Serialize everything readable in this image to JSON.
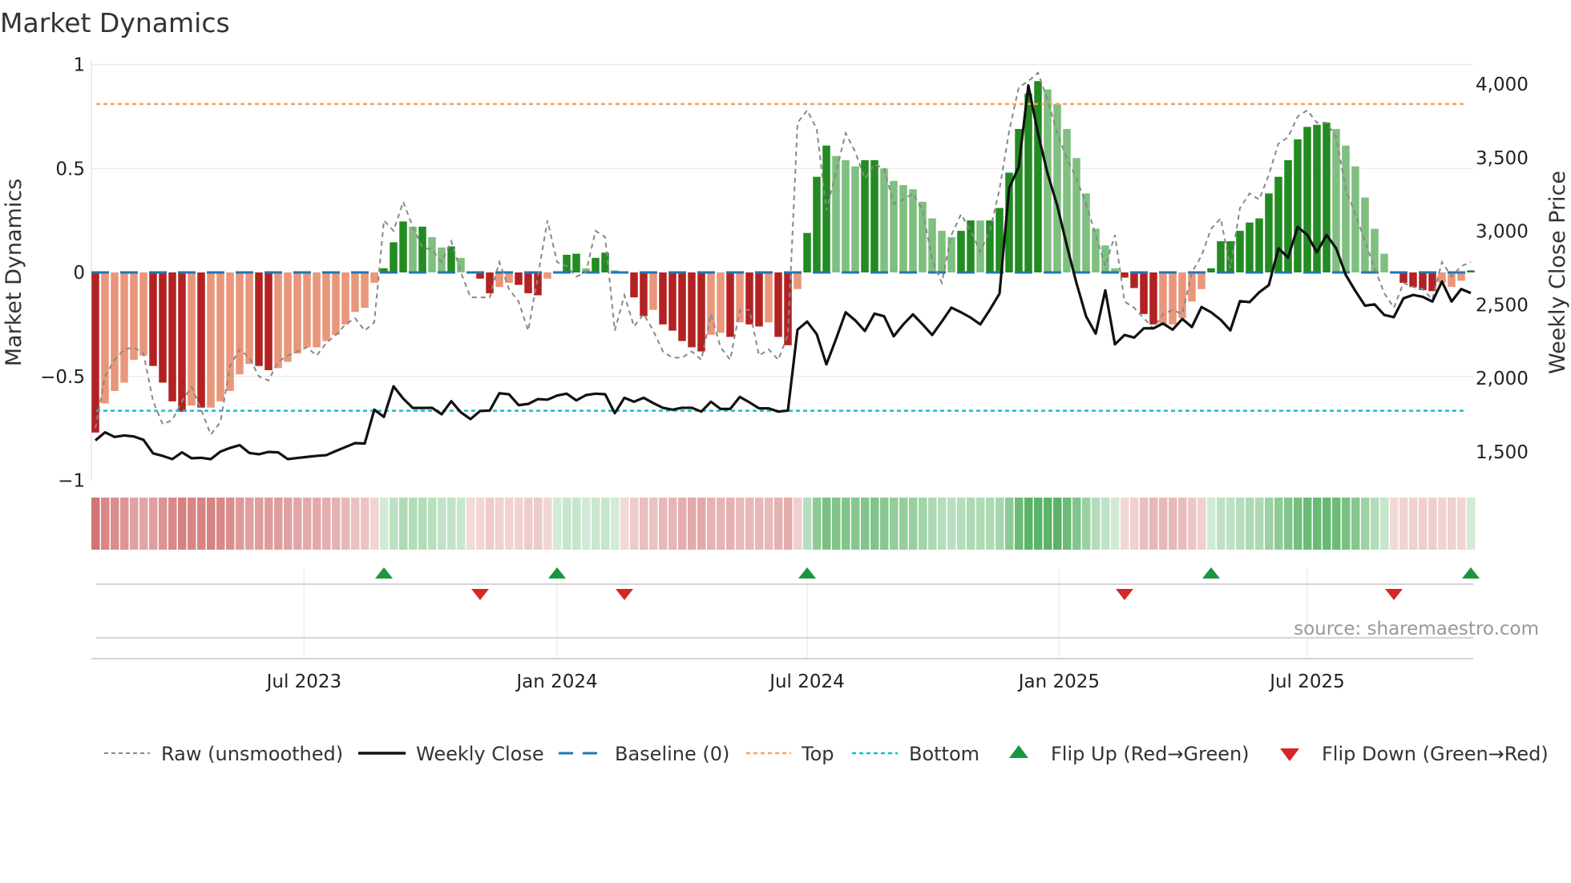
{
  "chart_data": {
    "type": "bar",
    "title": "Market Dynamics",
    "ylabel": "Market Dynamics",
    "y2label": "Weekly Close Price",
    "ylim": [
      -1,
      1
    ],
    "y2lim": [
      1200,
      4250
    ],
    "yticks": [
      {
        "v": 1,
        "label": "1"
      },
      {
        "v": 0.5,
        "label": "0.5"
      },
      {
        "v": 0,
        "label": "0"
      },
      {
        "v": -0.5,
        "label": "−0.5"
      },
      {
        "v": -1,
        "label": "−1"
      }
    ],
    "y2ticks": [
      {
        "v": 4000,
        "label": "4,000"
      },
      {
        "v": 3500,
        "label": "3,500"
      },
      {
        "v": 3000,
        "label": "3,000"
      },
      {
        "v": 2500,
        "label": "2,500"
      },
      {
        "v": 2000,
        "label": "2,000"
      },
      {
        "v": 1500,
        "label": "1,500"
      }
    ],
    "x_unit": "week index",
    "xticks": [
      {
        "week": 21.7,
        "label": "Jul 2023"
      },
      {
        "week": 48,
        "label": "Jan 2024"
      },
      {
        "week": 74,
        "label": "Jul 2024"
      },
      {
        "week": 100.2,
        "label": "Jan 2025"
      },
      {
        "week": 126,
        "label": "Jul 2025"
      }
    ],
    "top_level": 0.81,
    "bottom_level": -0.665,
    "baseline": 0,
    "values": [
      -0.77,
      -0.63,
      -0.57,
      -0.53,
      -0.42,
      -0.4,
      -0.45,
      -0.53,
      -0.62,
      -0.67,
      -0.64,
      -0.65,
      -0.65,
      -0.62,
      -0.57,
      -0.49,
      -0.44,
      -0.45,
      -0.47,
      -0.46,
      -0.43,
      -0.39,
      -0.36,
      -0.36,
      -0.33,
      -0.3,
      -0.25,
      -0.19,
      -0.17,
      -0.05,
      0.02,
      0.145,
      0.245,
      0.22,
      0.22,
      0.17,
      0.12,
      0.125,
      0.07,
      -0.005,
      -0.03,
      -0.1,
      -0.07,
      -0.05,
      -0.06,
      -0.1,
      -0.11,
      -0.03,
      0.0,
      0.085,
      0.09,
      0.02,
      0.07,
      0.095,
      0.01,
      -0.003,
      -0.12,
      -0.21,
      -0.18,
      -0.25,
      -0.28,
      -0.33,
      -0.36,
      -0.38,
      -0.3,
      -0.29,
      -0.31,
      -0.24,
      -0.25,
      -0.26,
      -0.24,
      -0.31,
      -0.35,
      -0.08,
      0.19,
      0.46,
      0.61,
      0.56,
      0.54,
      0.51,
      0.54,
      0.54,
      0.5,
      0.44,
      0.42,
      0.4,
      0.34,
      0.26,
      0.2,
      0.17,
      0.2,
      0.25,
      0.25,
      0.25,
      0.31,
      0.48,
      0.69,
      0.86,
      0.92,
      0.88,
      0.81,
      0.69,
      0.55,
      0.38,
      0.21,
      0.13,
      0.02,
      -0.025,
      -0.075,
      -0.2,
      -0.25,
      -0.25,
      -0.25,
      -0.22,
      -0.14,
      -0.08,
      0.02,
      0.15,
      0.15,
      0.2,
      0.24,
      0.26,
      0.38,
      0.46,
      0.54,
      0.64,
      0.7,
      0.71,
      0.72,
      0.69,
      0.61,
      0.51,
      0.36,
      0.21,
      0.09,
      -0.005,
      -0.05,
      -0.07,
      -0.085,
      -0.09,
      -0.05,
      -0.07,
      -0.04,
      0.01
    ],
    "emphasis": [
      1,
      0,
      0,
      0,
      0,
      0,
      1,
      1,
      1,
      1,
      0,
      1,
      0,
      0,
      0,
      0,
      0,
      1,
      1,
      0,
      0,
      0,
      0,
      0,
      0,
      0,
      0,
      0,
      0,
      0,
      1,
      1,
      1,
      0,
      1,
      0,
      0,
      1,
      0,
      1,
      1,
      1,
      0,
      0,
      1,
      1,
      1,
      0,
      1,
      1,
      1,
      0,
      1,
      1,
      0,
      1,
      1,
      1,
      0,
      1,
      1,
      1,
      1,
      1,
      0,
      0,
      1,
      0,
      1,
      1,
      0,
      1,
      1,
      0,
      1,
      1,
      1,
      0,
      0,
      0,
      1,
      1,
      0,
      0,
      0,
      0,
      0,
      0,
      0,
      0,
      1,
      1,
      0,
      1,
      1,
      1,
      1,
      1,
      1,
      0,
      0,
      0,
      0,
      0,
      0,
      0,
      0,
      1,
      1,
      1,
      1,
      0,
      0,
      0,
      0,
      0,
      1,
      1,
      1,
      1,
      1,
      1,
      1,
      1,
      1,
      1,
      1,
      1,
      1,
      0,
      0,
      0,
      0,
      0,
      0,
      1,
      1,
      1,
      1,
      1,
      0,
      0,
      0,
      1
    ],
    "raw": [
      -0.75,
      -0.5,
      -0.42,
      -0.37,
      -0.36,
      -0.39,
      -0.62,
      -0.73,
      -0.71,
      -0.62,
      -0.55,
      -0.66,
      -0.78,
      -0.72,
      -0.45,
      -0.37,
      -0.41,
      -0.5,
      -0.52,
      -0.43,
      -0.4,
      -0.38,
      -0.36,
      -0.4,
      -0.34,
      -0.3,
      -0.25,
      -0.22,
      -0.28,
      -0.24,
      0.25,
      0.2,
      0.34,
      0.22,
      0.12,
      0.11,
      0.05,
      0.15,
      0.0,
      -0.12,
      -0.12,
      -0.12,
      0.05,
      -0.08,
      -0.14,
      -0.28,
      -0.02,
      0.25,
      0.05,
      0.03,
      -0.02,
      0.0,
      0.2,
      0.17,
      -0.28,
      -0.11,
      -0.26,
      -0.2,
      -0.28,
      -0.38,
      -0.41,
      -0.41,
      -0.38,
      -0.42,
      -0.2,
      -0.36,
      -0.42,
      -0.18,
      -0.18,
      -0.4,
      -0.37,
      -0.42,
      -0.3,
      0.72,
      0.78,
      0.69,
      0.3,
      0.48,
      0.67,
      0.58,
      0.45,
      0.52,
      0.5,
      0.33,
      0.35,
      0.38,
      0.3,
      0.06,
      -0.05,
      0.18,
      0.28,
      0.2,
      0.1,
      0.2,
      0.4,
      0.68,
      0.89,
      0.92,
      0.96,
      0.83,
      0.67,
      0.55,
      0.45,
      0.33,
      0.18,
      0.03,
      0.18,
      -0.14,
      -0.17,
      -0.22,
      -0.27,
      -0.2,
      -0.18,
      -0.2,
      0.0,
      0.08,
      0.21,
      0.26,
      0.02,
      0.31,
      0.38,
      0.35,
      0.47,
      0.62,
      0.65,
      0.75,
      0.78,
      0.72,
      0.72,
      0.65,
      0.4,
      0.28,
      0.15,
      0.02,
      -0.1,
      -0.17,
      -0.05,
      -0.07,
      -0.08,
      -0.13,
      0.05,
      -0.02,
      0.03,
      0.05
    ],
    "weekly_close": [
      1578,
      1633,
      1602,
      1612,
      1605,
      1582,
      1490,
      1473,
      1451,
      1497,
      1457,
      1460,
      1451,
      1502,
      1527,
      1546,
      1493,
      1484,
      1500,
      1497,
      1451,
      1459,
      1466,
      1473,
      1478,
      1506,
      1533,
      1560,
      1557,
      1787,
      1738,
      1946,
      1863,
      1799,
      1799,
      1800,
      1756,
      1845,
      1769,
      1723,
      1778,
      1781,
      1899,
      1892,
      1818,
      1826,
      1859,
      1855,
      1883,
      1896,
      1850,
      1886,
      1896,
      1892,
      1763,
      1868,
      1841,
      1868,
      1832,
      1800,
      1787,
      1800,
      1800,
      1774,
      1841,
      1792,
      1792,
      1874,
      1837,
      1796,
      1796,
      1774,
      1781,
      2331,
      2386,
      2300,
      2095,
      2267,
      2449,
      2394,
      2322,
      2440,
      2422,
      2286,
      2367,
      2435,
      2367,
      2295,
      2386,
      2481,
      2449,
      2413,
      2367,
      2467,
      2576,
      3293,
      3438,
      3991,
      3665,
      3392,
      3175,
      2903,
      2648,
      2422,
      2304,
      2598,
      2231,
      2295,
      2277,
      2340,
      2340,
      2373,
      2331,
      2404,
      2349,
      2485,
      2449,
      2398,
      2326,
      2525,
      2518,
      2585,
      2634,
      2884,
      2821,
      3029,
      2975,
      2857,
      2975,
      2884,
      2703,
      2594,
      2494,
      2503,
      2431,
      2416,
      2544,
      2567,
      2554,
      2522,
      2658,
      2522,
      2607,
      2580
    ],
    "flip_up_weeks": [
      30,
      48,
      74,
      116,
      143
    ],
    "flip_down_weeks": [
      40,
      55,
      107,
      135
    ],
    "legend": [
      {
        "key": "raw",
        "label": "Raw (unsmoothed)"
      },
      {
        "key": "close",
        "label": "Weekly Close"
      },
      {
        "key": "baseline",
        "label": "Baseline (0)"
      },
      {
        "key": "top",
        "label": "Top"
      },
      {
        "key": "bottom",
        "label": "Bottom"
      },
      {
        "key": "flip_up",
        "label": "Flip Up (Red→Green)"
      },
      {
        "key": "flip_down",
        "label": "Flip Down (Green→Red)"
      }
    ],
    "legend_position": "bottom",
    "source": "source: sharemaestro.com",
    "colors": {
      "strong_green": "#228b22",
      "weak_green": "#7fbf7f",
      "strong_red": "#b22222",
      "weak_red": "#e9967a",
      "close": "#111111",
      "raw": "#888888",
      "baseline": "#1f77b4",
      "top": "#f4a460",
      "bottom": "#17becf",
      "flip_up": "#1a9641",
      "flip_down": "#d62728"
    }
  }
}
